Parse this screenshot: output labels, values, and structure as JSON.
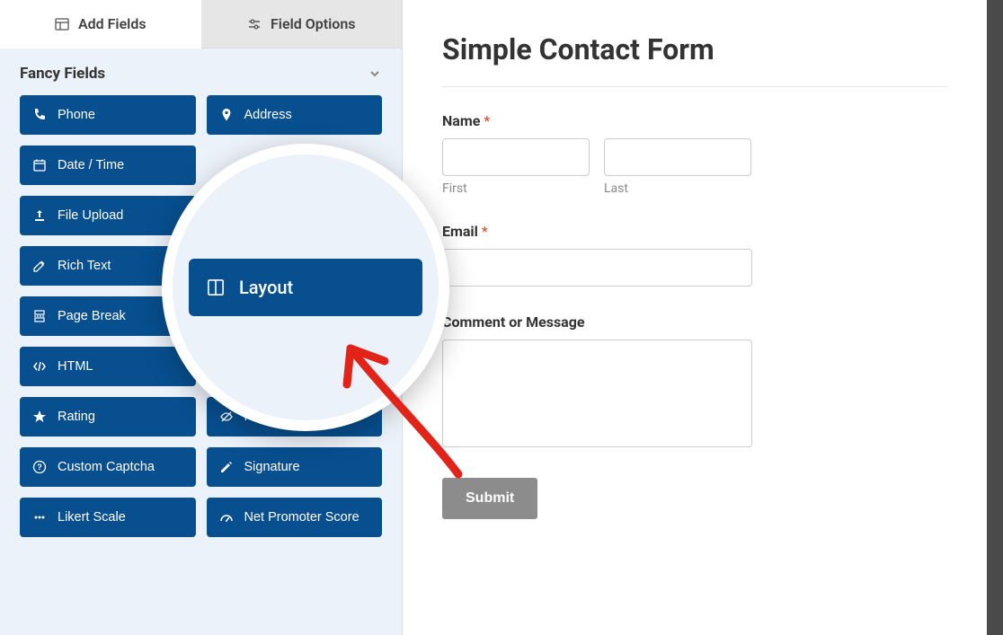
{
  "tabs": {
    "add_fields": "Add Fields",
    "field_options": "Field Options"
  },
  "section": {
    "title": "Fancy Fields"
  },
  "fields": {
    "phone": "Phone",
    "address": "Address",
    "datetime": "Date / Time",
    "file_upload": "File Upload",
    "rich_text": "Rich Text",
    "page_break": "Page Break",
    "html": "HTML",
    "rating": "Rating",
    "hidden_field": "Hidden Field",
    "custom_captcha": "Custom Captcha",
    "signature": "Signature",
    "likert": "Likert Scale",
    "nps": "Net Promoter Score",
    "layout": "Layout"
  },
  "form": {
    "title": "Simple Contact Form",
    "name_label": "Name",
    "first_label": "First",
    "last_label": "Last",
    "email_label": "Email",
    "comment_label": "Comment or Message",
    "submit": "Submit",
    "required_mark": "*"
  }
}
